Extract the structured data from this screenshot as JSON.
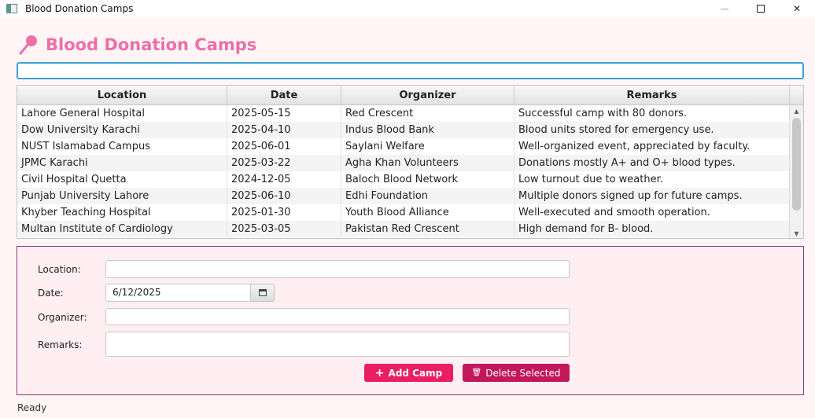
{
  "window": {
    "title": "Blood Donation Camps"
  },
  "header": {
    "title": "Blood Donation Camps",
    "icon": "blood-drop-pin-icon",
    "title_color": "#ec6fa6"
  },
  "search": {
    "value": "",
    "placeholder": ""
  },
  "table": {
    "columns": [
      "Location",
      "Date",
      "Organizer",
      "Remarks"
    ],
    "rows": [
      [
        "Lahore General Hospital",
        "2025-05-15",
        "Red Crescent",
        "Successful camp with 80 donors."
      ],
      [
        "Dow University Karachi",
        "2025-04-10",
        "Indus Blood Bank",
        "Blood units stored for emergency use."
      ],
      [
        "NUST Islamabad Campus",
        "2025-06-01",
        "Saylani Welfare",
        "Well-organized event, appreciated by faculty."
      ],
      [
        "JPMC Karachi",
        "2025-03-22",
        "Agha Khan Volunteers",
        "Donations mostly A+ and O+ blood types."
      ],
      [
        "Civil Hospital Quetta",
        "2024-12-05",
        "Baloch Blood Network",
        "Low turnout due to weather."
      ],
      [
        "Punjab University Lahore",
        "2025-06-10",
        "Edhi Foundation",
        "Multiple donors signed up for future camps."
      ],
      [
        "Khyber Teaching Hospital",
        "2025-01-30",
        "Youth Blood Alliance",
        "Well-executed and smooth operation."
      ],
      [
        "Multan Institute of Cardiology",
        "2025-03-05",
        "Pakistan Red Crescent",
        "High demand for B- blood."
      ]
    ]
  },
  "form": {
    "location_label": "Location:",
    "location_value": "",
    "date_label": "Date:",
    "date_value": "6/12/2025",
    "organizer_label": "Organizer:",
    "organizer_value": "",
    "remarks_label": "Remarks:",
    "remarks_value": "",
    "add_button": "Add Camp",
    "delete_button": "Delete Selected",
    "add_color": "#e91e63",
    "delete_color": "#c2185b"
  },
  "status": "Ready"
}
